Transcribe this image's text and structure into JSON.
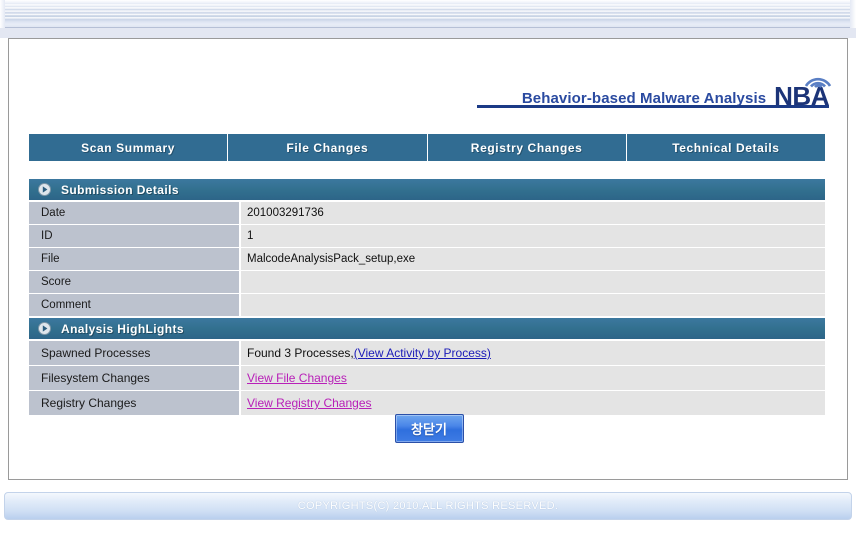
{
  "window": {
    "chrome_style": "popup-titlebar"
  },
  "brand": {
    "tagline": "Behavior-based Malware Analysis",
    "logo_text": "NBA",
    "logo_icon": "wifi-arc-icon"
  },
  "tabs": [
    {
      "label": "Scan Summary",
      "name": "tab-scan-summary",
      "active": true
    },
    {
      "label": "File Changes",
      "name": "tab-file-changes",
      "active": false
    },
    {
      "label": "Registry Changes",
      "name": "tab-registry-changes",
      "active": false
    },
    {
      "label": "Technical Details",
      "name": "tab-technical-details",
      "active": false
    }
  ],
  "sections": [
    {
      "title": "Submission Details",
      "icon": "play-circle-icon",
      "rows": [
        {
          "label": "Date",
          "value": "201003291736"
        },
        {
          "label": "ID",
          "value": "1"
        },
        {
          "label": "File",
          "value": "MalcodeAnalysisPack_setup,exe"
        },
        {
          "label": "Score",
          "value": ""
        },
        {
          "label": "Comment",
          "value": ""
        }
      ]
    },
    {
      "title": "Analysis HighLights",
      "icon": "play-circle-icon",
      "rows": [
        {
          "label": "Spawned Processes",
          "value_prefix": "Found 3 Processes, ",
          "link_text": "(View Activity by Process)",
          "link_state": "unvisited"
        },
        {
          "label": "Filesystem Changes",
          "value_prefix": "",
          "link_text": "View File Changes",
          "link_state": "visited"
        },
        {
          "label": "Registry Changes",
          "value_prefix": "",
          "link_text": "View Registry Changes",
          "link_state": "visited"
        }
      ]
    }
  ],
  "close_button": {
    "label": "창닫기"
  },
  "footer": {
    "text": "COPYRIGHTS(C) 2010.ALL RIGHTS RESERVED."
  },
  "colors": {
    "tab_bar": "#316c92",
    "section_header": "#32708f",
    "row_label_bg": "#bcc2ce",
    "row_value_bg": "#e4e4e4",
    "link_unvisited": "#1b1bb8",
    "link_visited": "#b820b8",
    "brand_blue": "#2a4aa0",
    "logo_navy": "#1c3478",
    "button_blue": "#4a86e8"
  }
}
